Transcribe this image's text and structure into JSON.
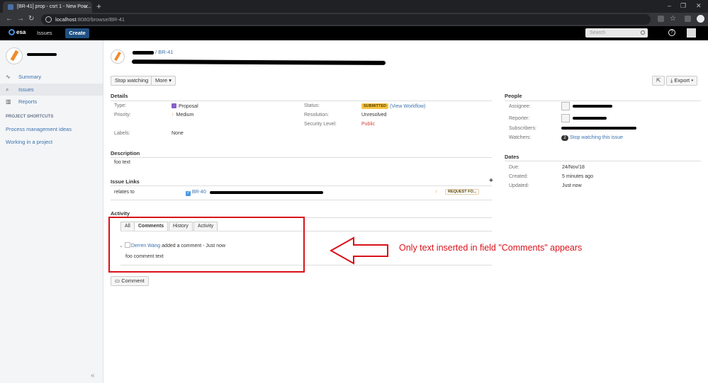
{
  "browser": {
    "tab_title": "[BR-41] prop - csrt 1 - New Pow...",
    "url_host": "localhost",
    "url_path": ":8080/browse/BR-41"
  },
  "topnav": {
    "logo": "esa",
    "issues": "Issues",
    "create": "Create",
    "search_placeholder": "Search"
  },
  "sidebar": {
    "items": [
      {
        "label": "Summary",
        "icon": "pulse-icon"
      },
      {
        "label": "Issues",
        "icon": "search-icon"
      },
      {
        "label": "Reports",
        "icon": "chart-icon"
      }
    ],
    "shortcuts_heading": "PROJECT SHORTCUTS",
    "shortcuts": [
      "Process management ideas",
      "Working in a project"
    ],
    "collapse": "«"
  },
  "issue": {
    "key": "BR-41",
    "crumb_sep": "/",
    "buttons": {
      "stop_watching": "Stop watching",
      "more": "More",
      "export": "Export"
    }
  },
  "details": {
    "heading": "Details",
    "type_label": "Type:",
    "type_value": "Proposal",
    "priority_label": "Priority:",
    "priority_value": "Medium",
    "labels_label": "Labels:",
    "labels_value": "None",
    "status_label": "Status:",
    "status_value": "SUBMITTED",
    "view_workflow": "(View Workflow)",
    "resolution_label": "Resolution:",
    "resolution_value": "Unresolved",
    "security_label": "Security Level:",
    "security_value": "Public"
  },
  "description": {
    "heading": "Description",
    "text": "foo text"
  },
  "links": {
    "heading": "Issue Links",
    "add": "+",
    "relates": "relates to",
    "linked_key": "BR-40",
    "linked_status": "REQUEST FO..."
  },
  "activity": {
    "heading": "Activity",
    "tabs": [
      "All",
      "Comments",
      "History",
      "Activity"
    ],
    "comment_author": "Derren Wang",
    "comment_meta": "added a comment - Just now",
    "comment_text": "foo comment text",
    "comment_button": "Comment"
  },
  "people": {
    "heading": "People",
    "assignee_label": "Assignee:",
    "reporter_label": "Reporter:",
    "subscribers_label": "Subscribers:",
    "watchers_label": "Watchers:",
    "watchers_count": "2",
    "watch_link": "Stop watching this issue"
  },
  "dates": {
    "heading": "Dates",
    "due_label": "Due:",
    "due_value": "24/Nov/18",
    "created_label": "Created:",
    "created_value": "5 minutes ago",
    "updated_label": "Updated:",
    "updated_value": "Just now"
  },
  "annotation": {
    "text": "Only text inserted in field \"Comments\" appears",
    "color": "#d9121a"
  }
}
